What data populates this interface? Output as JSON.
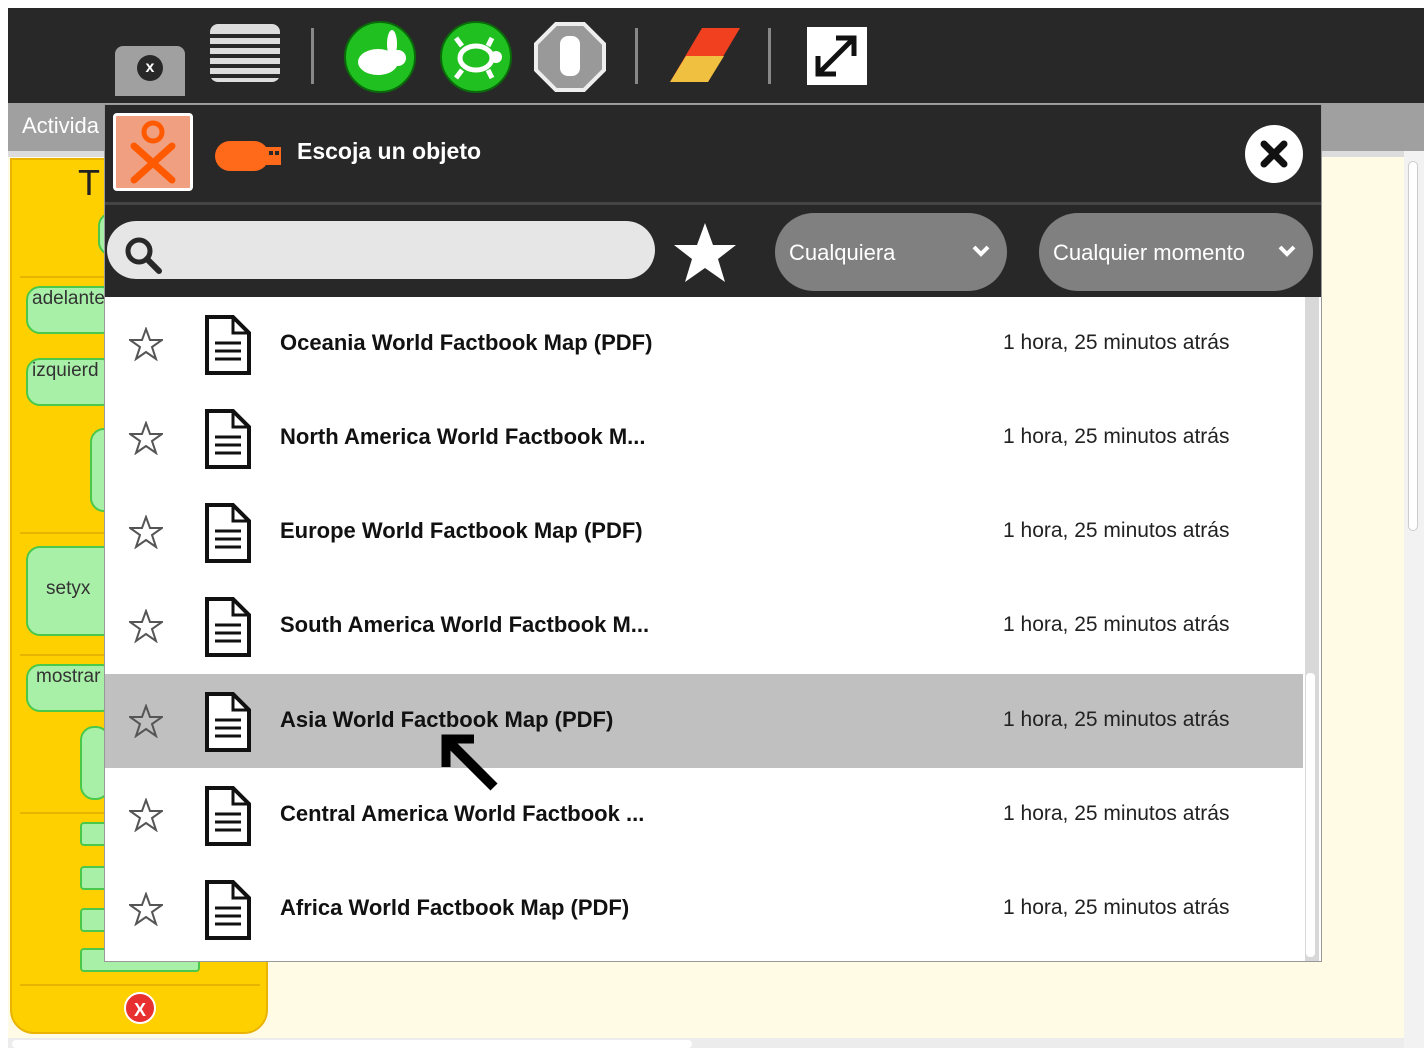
{
  "toolbar": {
    "close_tab_label": "x",
    "icons": [
      "view-icon",
      "run-fast-icon",
      "run-step-icon",
      "stop-icon",
      "eraser-icon",
      "fullscreen-icon"
    ]
  },
  "activity_bar": {
    "label": "Activida"
  },
  "palette": {
    "title": "T",
    "blocks": [
      "adelante",
      "izquierd",
      "setyx",
      "mostrar"
    ],
    "close_label": "X"
  },
  "dialog": {
    "title": "Escoja un objeto",
    "search": {
      "value": "",
      "placeholder": ""
    },
    "filter_type": "Cualquiera",
    "filter_time": "Cualquier momento",
    "items": [
      {
        "title": "Oceania World Factbook Map (PDF)",
        "time": "1 hora, 25 minutos atrás",
        "selected": false
      },
      {
        "title": "North America World Factbook M...",
        "time": "1 hora, 25 minutos atrás",
        "selected": false
      },
      {
        "title": "Europe World Factbook Map (PDF)",
        "time": "1 hora, 25 minutos atrás",
        "selected": false
      },
      {
        "title": "South America World Factbook M...",
        "time": "1 hora, 25 minutos atrás",
        "selected": false
      },
      {
        "title": "Asia World Factbook Map (PDF)",
        "time": "1 hora, 25 minutos atrás",
        "selected": true
      },
      {
        "title": "Central America World Factbook ...",
        "time": "1 hora, 25 minutos atrás",
        "selected": false
      },
      {
        "title": "Africa World Factbook Map (PDF)",
        "time": "1 hora, 25 minutos atrás",
        "selected": false
      }
    ]
  },
  "colors": {
    "toolbar_bg": "#282828",
    "selected_row": "#c0c0c0",
    "palette": "#ffd000",
    "xo_orange": "#ff6a00"
  }
}
